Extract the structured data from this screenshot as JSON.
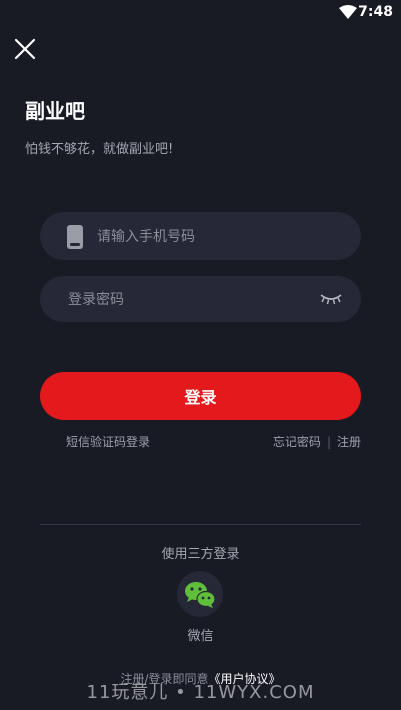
{
  "status_bar": {
    "time": "7:48"
  },
  "app": {
    "title": "副业吧",
    "subtitle": "怕钱不够花，就做副业吧!"
  },
  "form": {
    "phone_placeholder": "请输入手机号码",
    "password_placeholder": "登录密码",
    "login_label": "登录"
  },
  "links": {
    "sms_login": "短信验证码登录",
    "forgot_password": "忘记密码",
    "separator": "|",
    "register": "注册"
  },
  "third_party": {
    "label": "使用三方登录",
    "wechat_label": "微信"
  },
  "agreement": {
    "prefix": "注册/登录即同意",
    "document": "《用户协议》"
  },
  "watermark": "11玩意儿 • 11WYX.COM",
  "icons": {
    "close": "close-icon",
    "phone": "phone-icon",
    "eye": "eye-closed-icon",
    "wechat": "wechat-icon",
    "wifi": "wifi-icon"
  },
  "colors": {
    "background": "#181a24",
    "field": "#262837",
    "accent": "#e4191c",
    "wechat_green": "#5fbf3a"
  }
}
